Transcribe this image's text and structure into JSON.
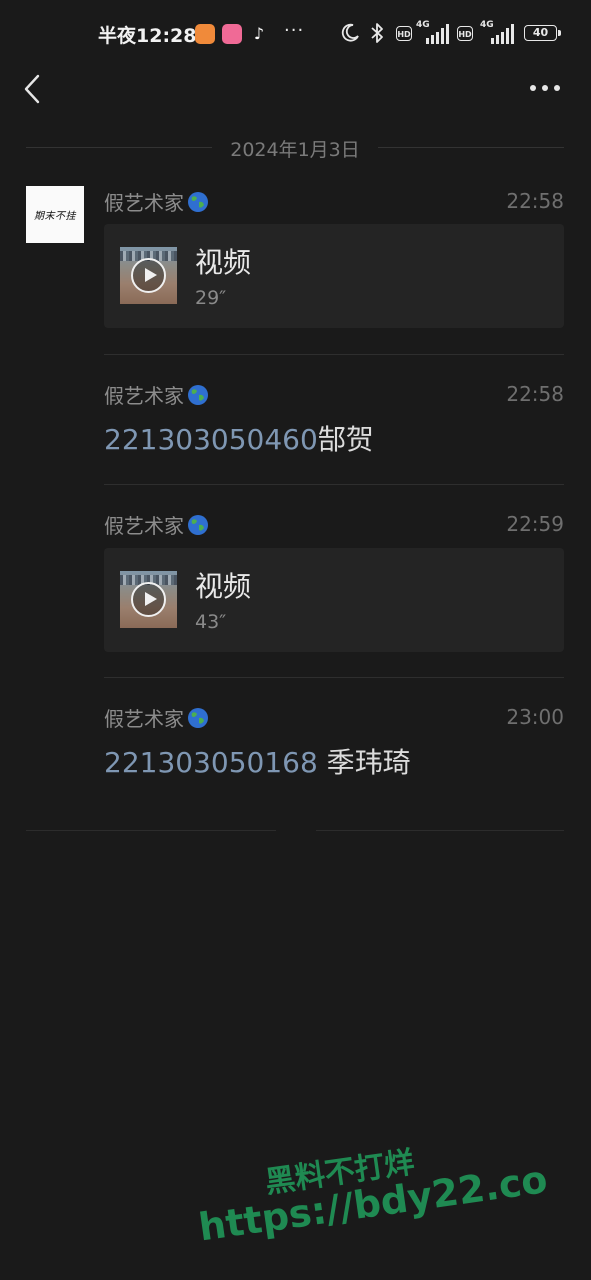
{
  "status_bar": {
    "time": "半夜12:28",
    "more": "···",
    "network_a": "4G",
    "network_b": "4G",
    "hd_a": "HD",
    "hd_b": "HD",
    "battery": "40"
  },
  "chat": {
    "date": "2024年1月3日",
    "avatar_text": "期末不挂",
    "messages": [
      {
        "sender": "假艺术家",
        "time": "22:58",
        "type": "video",
        "title": "视频",
        "duration": "29″"
      },
      {
        "sender": "假艺术家",
        "time": "22:58",
        "type": "text",
        "number": "221303050460",
        "name": "郜贺"
      },
      {
        "sender": "假艺术家",
        "time": "22:59",
        "type": "video",
        "title": "视频",
        "duration": "43″"
      },
      {
        "sender": "假艺术家",
        "time": "23:00",
        "type": "text",
        "number": "221303050168",
        "name": " 季玮琦"
      }
    ]
  },
  "watermark": {
    "line1": "黑料不打烊",
    "line2": "https://bdy22.co"
  },
  "colors": {
    "background": "#1a1a1a",
    "card": "#242424",
    "link": "#7f97b3",
    "watermark": "#1f8a52"
  }
}
